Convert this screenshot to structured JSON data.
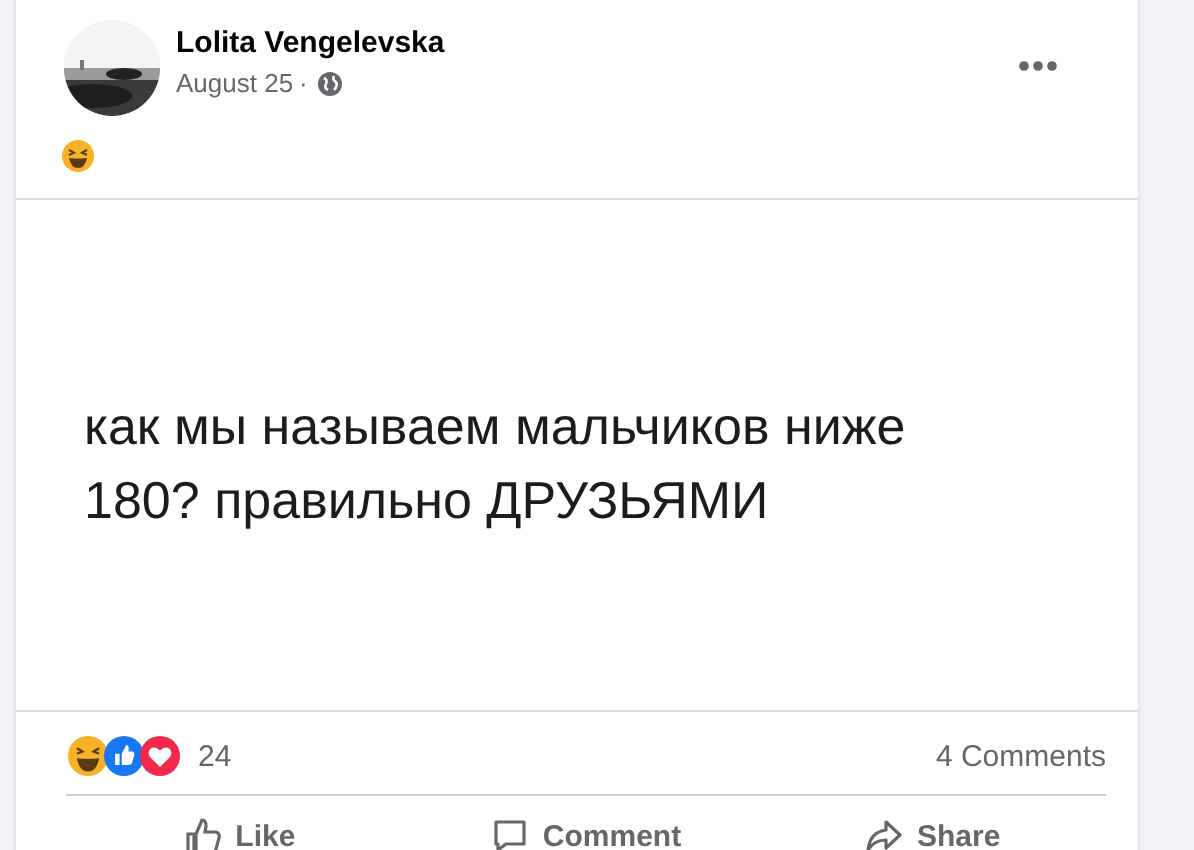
{
  "post": {
    "author": "Lolita Vengelevska",
    "date": "August 25",
    "separator": "·",
    "image_text": "как мы называем мальчиков ниже 180? правильно ДРУЗЬЯМИ",
    "reaction_count": "24",
    "comments": "4 Comments",
    "actions": [
      {
        "label": "Like",
        "kind": "like"
      },
      {
        "label": "Comment",
        "kind": "comment"
      },
      {
        "label": "Share",
        "kind": "share"
      }
    ]
  }
}
